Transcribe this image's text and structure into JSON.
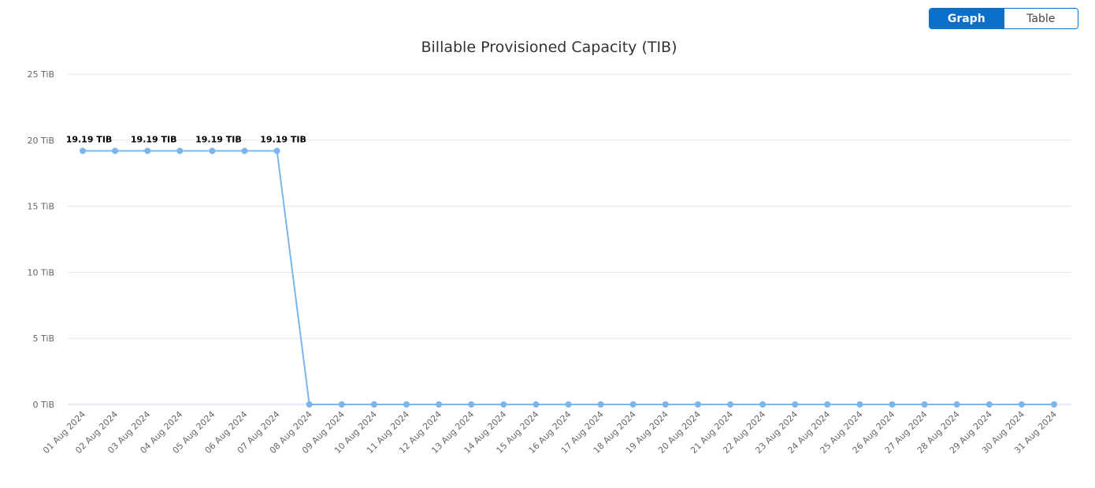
{
  "view_toggle": {
    "graph_label": "Graph",
    "table_label": "Table",
    "active": "Graph"
  },
  "colors": {
    "accent": "#0a6fc8",
    "series": "#7cb5ec",
    "grid": "#e6e6e6"
  },
  "chart_data": {
    "type": "line",
    "title": "Billable Provisioned Capacity (TIB)",
    "xlabel": "",
    "ylabel": "",
    "ylim": [
      0,
      25
    ],
    "yticks": [
      0,
      5,
      10,
      15,
      20,
      25
    ],
    "ytick_labels": [
      "0 TiB",
      "5 TiB",
      "10 TiB",
      "15 TiB",
      "20 TiB",
      "25 TiB"
    ],
    "grid": true,
    "legend": "none",
    "categories": [
      "01 Aug 2024",
      "02 Aug 2024",
      "03 Aug 2024",
      "04 Aug 2024",
      "05 Aug 2024",
      "06 Aug 2024",
      "07 Aug 2024",
      "08 Aug 2024",
      "09 Aug 2024",
      "10 Aug 2024",
      "11 Aug 2024",
      "12 Aug 2024",
      "13 Aug 2024",
      "14 Aug 2024",
      "15 Aug 2024",
      "16 Aug 2024",
      "17 Aug 2024",
      "18 Aug 2024",
      "19 Aug 2024",
      "20 Aug 2024",
      "21 Aug 2024",
      "22 Aug 2024",
      "23 Aug 2024",
      "24 Aug 2024",
      "25 Aug 2024",
      "26 Aug 2024",
      "27 Aug 2024",
      "28 Aug 2024",
      "29 Aug 2024",
      "30 Aug 2024",
      "31 Aug 2024"
    ],
    "series": [
      {
        "name": "Billable Provisioned Capacity",
        "values": [
          19.19,
          19.19,
          19.19,
          19.19,
          19.19,
          19.19,
          19.19,
          0,
          0,
          0,
          0,
          0,
          0,
          0,
          0,
          0,
          0,
          0,
          0,
          0,
          0,
          0,
          0,
          0,
          0,
          0,
          0,
          0,
          0,
          0,
          0
        ]
      }
    ],
    "data_labels": [
      {
        "index": 0,
        "text": "19.19 TIB"
      },
      {
        "index": 2,
        "text": "19.19 TIB"
      },
      {
        "index": 4,
        "text": "19.19 TIB"
      },
      {
        "index": 6,
        "text": "19.19 TIB"
      }
    ]
  }
}
